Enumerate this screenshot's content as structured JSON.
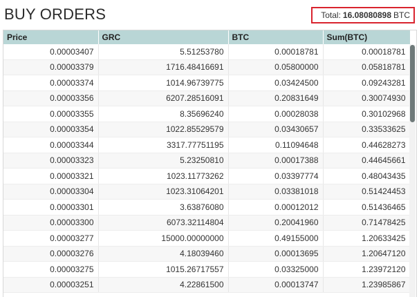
{
  "title": "BUY ORDERS",
  "total": {
    "label": "Total:",
    "value": "16.08080898",
    "unit": "BTC"
  },
  "columns": [
    "Price",
    "GRC",
    "BTC",
    "Sum(BTC)"
  ],
  "rows": [
    [
      "0.00003407",
      "5.51253780",
      "0.00018781",
      "0.00018781"
    ],
    [
      "0.00003379",
      "1716.48416691",
      "0.05800000",
      "0.05818781"
    ],
    [
      "0.00003374",
      "1014.96739775",
      "0.03424500",
      "0.09243281"
    ],
    [
      "0.00003356",
      "6207.28516091",
      "0.20831649",
      "0.30074930"
    ],
    [
      "0.00003355",
      "8.35696240",
      "0.00028038",
      "0.30102968"
    ],
    [
      "0.00003354",
      "1022.85529579",
      "0.03430657",
      "0.33533625"
    ],
    [
      "0.00003344",
      "3317.77751195",
      "0.11094648",
      "0.44628273"
    ],
    [
      "0.00003323",
      "5.23250810",
      "0.00017388",
      "0.44645661"
    ],
    [
      "0.00003321",
      "1023.11773262",
      "0.03397774",
      "0.48043435"
    ],
    [
      "0.00003304",
      "1023.31064201",
      "0.03381018",
      "0.51424453"
    ],
    [
      "0.00003301",
      "3.63876080",
      "0.00012012",
      "0.51436465"
    ],
    [
      "0.00003300",
      "6073.32114804",
      "0.20041960",
      "0.71478425"
    ],
    [
      "0.00003277",
      "15000.00000000",
      "0.49155000",
      "1.20633425"
    ],
    [
      "0.00003276",
      "4.18039460",
      "0.00013695",
      "1.20647120"
    ],
    [
      "0.00003275",
      "1015.26717557",
      "0.03325000",
      "1.23972120"
    ],
    [
      "0.00003251",
      "4.22861500",
      "0.00013747",
      "1.23985867"
    ]
  ]
}
